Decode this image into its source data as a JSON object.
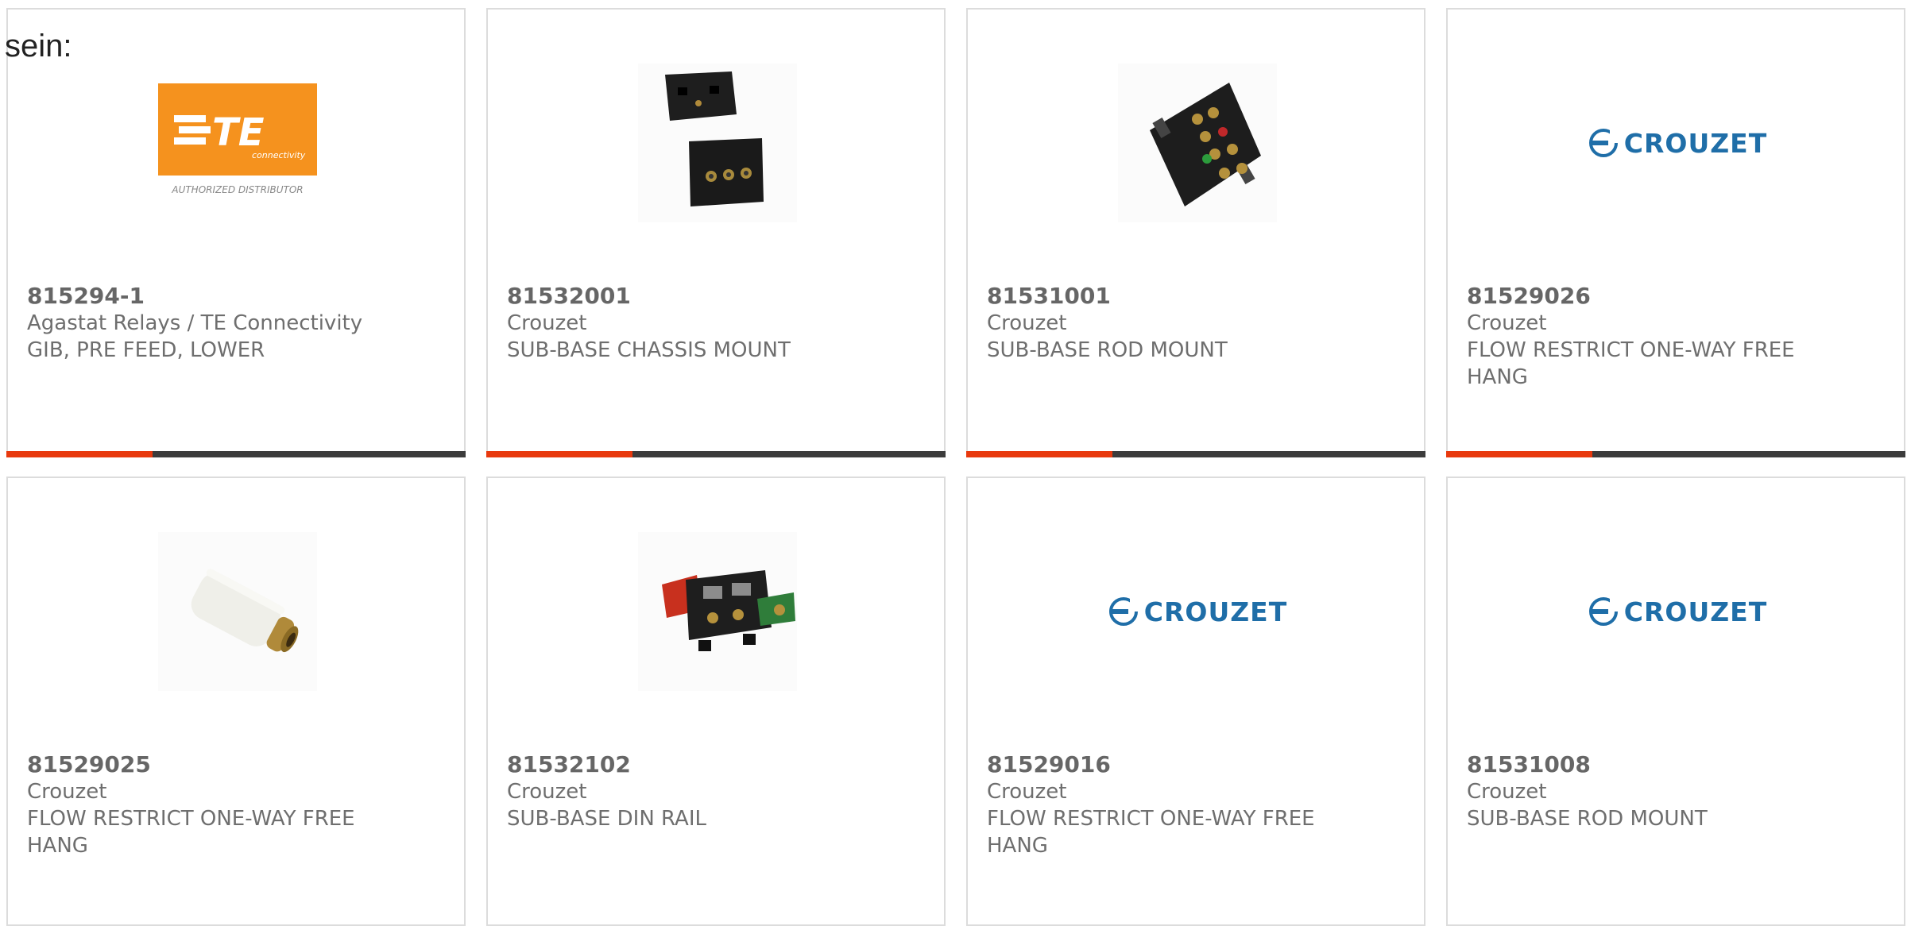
{
  "intro_text": "sein:",
  "colors": {
    "accent": "#e8390e",
    "bar_dark": "#3c3c3c",
    "crouzet_blue": "#1f6ea8",
    "te_orange": "#f5921e"
  },
  "logos": {
    "te_wordmark": "TE",
    "te_sub": "connectivity",
    "te_tagline": "AUTHORIZED DISTRIBUTOR",
    "crouzet_wordmark": "CROUZET"
  },
  "products": [
    {
      "part": "815294-1",
      "manufacturer": "Agastat Relays / TE Connectivity",
      "description": "GIB, PRE FEED, LOWER",
      "image": "te-logo"
    },
    {
      "part": "81532001",
      "manufacturer": "Crouzet",
      "description": "SUB-BASE CHASSIS MOUNT",
      "image": "subbase-chassis"
    },
    {
      "part": "81531001",
      "manufacturer": "Crouzet",
      "description": "SUB-BASE ROD MOUNT",
      "image": "subbase-rod"
    },
    {
      "part": "81529026",
      "manufacturer": "Crouzet",
      "description": "FLOW RESTRICT ONE-WAY FREE HANG",
      "image": "crouzet-logo"
    },
    {
      "part": "81529025",
      "manufacturer": "Crouzet",
      "description": "FLOW RESTRICT ONE-WAY FREE HANG",
      "image": "white-cylinder"
    },
    {
      "part": "81532102",
      "manufacturer": "Crouzet",
      "description": "SUB-BASE DIN RAIL",
      "image": "din-rail"
    },
    {
      "part": "81529016",
      "manufacturer": "Crouzet",
      "description": "FLOW RESTRICT ONE-WAY FREE HANG",
      "image": "crouzet-logo"
    },
    {
      "part": "81531008",
      "manufacturer": "Crouzet",
      "description": "SUB-BASE ROD MOUNT",
      "image": "crouzet-logo"
    }
  ]
}
